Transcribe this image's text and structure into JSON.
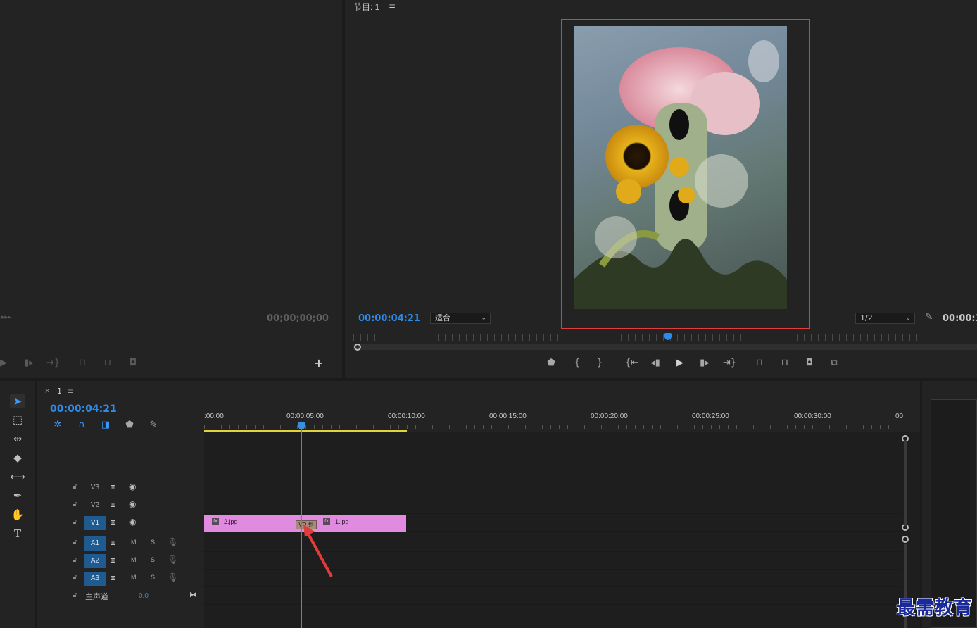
{
  "source_monitor": {
    "timecode": "00;00;00;00",
    "left_arrows": "▸▸▸",
    "add_icon": "+"
  },
  "program_monitor": {
    "title": "节目: 1",
    "menu_icon": "≡",
    "timecode": "00:00:04:21",
    "fit_label": "适合",
    "resolution_label": "1/2",
    "duration_partial": "00:00:1"
  },
  "timeline": {
    "sequence_name": "1",
    "timecode": "00:00:04:21",
    "ruler_labels": [
      ":00:00",
      "00:00:05:00",
      "00:00:10:00",
      "00:00:15:00",
      "00:00:20:00",
      "00:00:25:00",
      "00:00:30:00",
      "00"
    ],
    "tracks": {
      "v3": "V3",
      "v2": "V2",
      "v1": "V1",
      "a1": "A1",
      "a2": "A2",
      "a3": "A3",
      "master": "主声道",
      "master_value": "0.0"
    },
    "mute_label": "M",
    "solo_label": "S",
    "clips": {
      "clip1": "2.jpg",
      "clip2": "1.jpg",
      "fx": "fx",
      "transition": "VR 划"
    }
  },
  "watermark": "最需教育",
  "colors": {
    "accent_blue": "#2d8ceb",
    "clip_pink": "#e08ae0",
    "highlight_red": "#e23b3b",
    "work_area_yellow": "#e1d33c"
  }
}
